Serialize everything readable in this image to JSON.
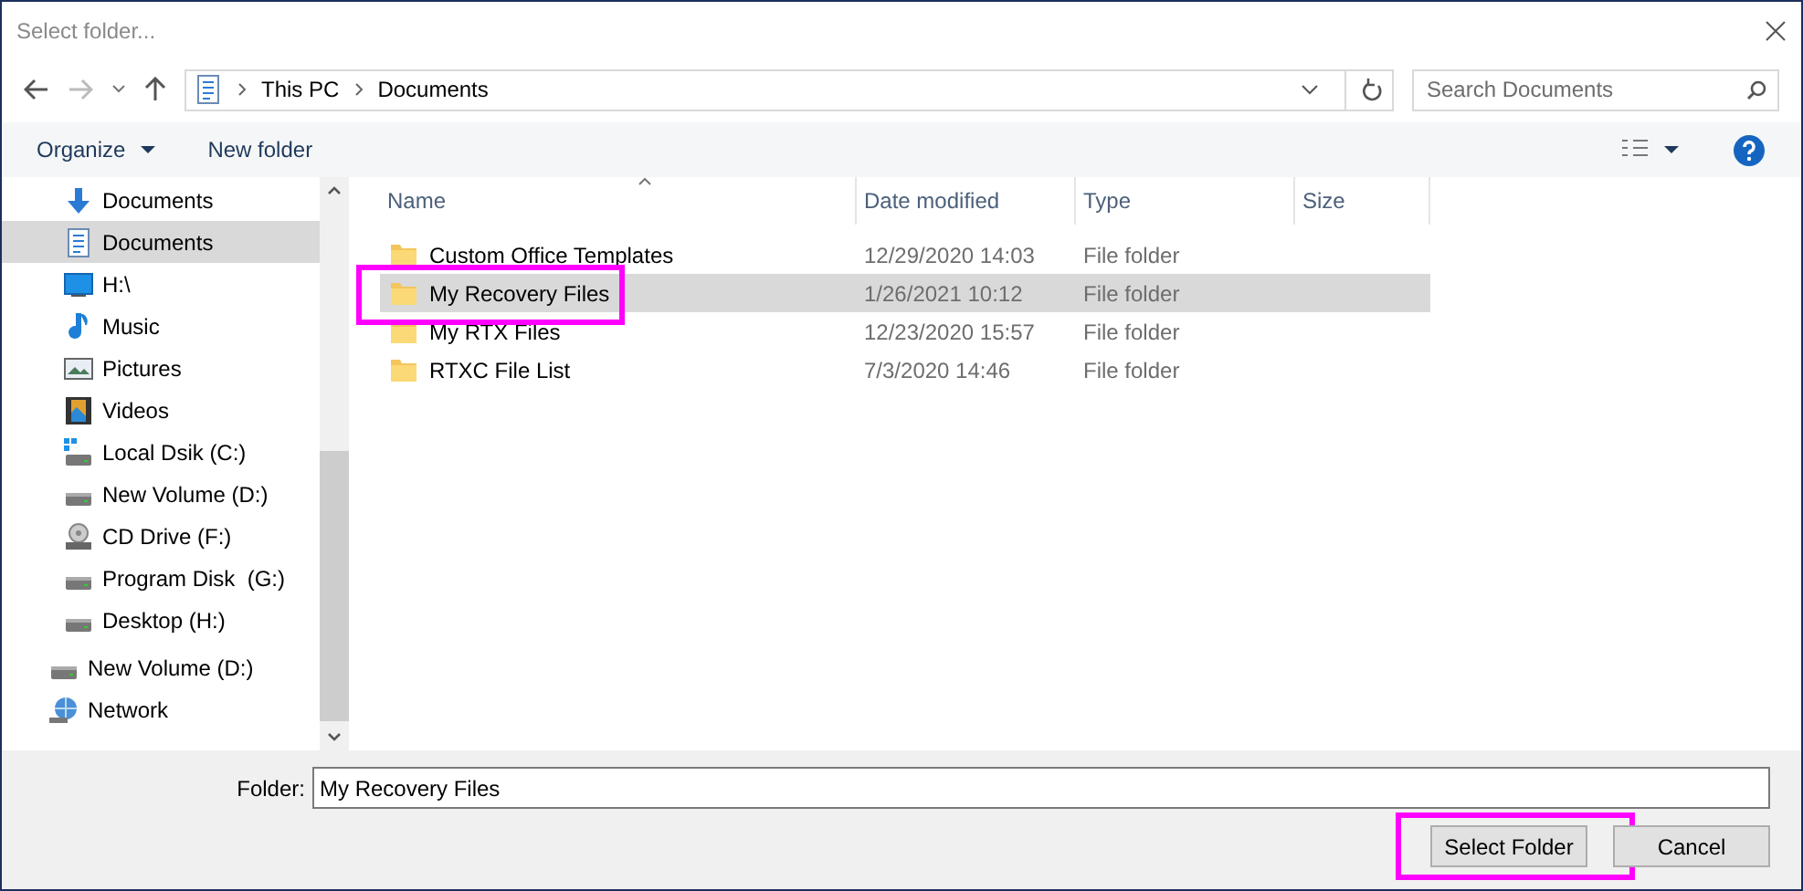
{
  "window": {
    "title": "Select folder..."
  },
  "address": {
    "path": [
      "This PC",
      "Documents"
    ]
  },
  "search": {
    "placeholder": "Search Documents"
  },
  "toolbar": {
    "organize": "Organize",
    "new_folder": "New folder"
  },
  "sidebar": {
    "items": [
      {
        "label": "Documents",
        "kind": "download",
        "selected": false
      },
      {
        "label": "Documents",
        "kind": "document",
        "selected": true
      },
      {
        "label": "H:\\",
        "kind": "monitor",
        "selected": false
      },
      {
        "label": "Music",
        "kind": "music",
        "selected": false
      },
      {
        "label": "Pictures",
        "kind": "picture",
        "selected": false
      },
      {
        "label": "Videos",
        "kind": "video",
        "selected": false
      },
      {
        "label": "Local Dsik (C:)",
        "kind": "system",
        "selected": false
      },
      {
        "label": "New Volume (D:)",
        "kind": "drive",
        "selected": false
      },
      {
        "label": "CD Drive (F:)",
        "kind": "cd",
        "selected": false
      },
      {
        "label": "Program Disk  (G:)",
        "kind": "drive",
        "selected": false
      },
      {
        "label": "Desktop (H:)",
        "kind": "drive",
        "selected": false
      }
    ],
    "top_level_items": [
      {
        "label": "New Volume (D:)",
        "kind": "drive",
        "selected": false
      },
      {
        "label": "Network",
        "kind": "network",
        "selected": false
      }
    ]
  },
  "table": {
    "columns": [
      "Name",
      "Date modified",
      "Type",
      "Size"
    ],
    "rows": [
      {
        "name": "Custom Office Templates",
        "date": "12/29/2020 14:03",
        "type": "File folder",
        "selected": false,
        "highlighted": false
      },
      {
        "name": "My Recovery Files",
        "date": "1/26/2021 10:12",
        "type": "File folder",
        "selected": true,
        "highlighted": true
      },
      {
        "name": "My RTX Files",
        "date": "12/23/2020 15:57",
        "type": "File folder",
        "selected": false,
        "highlighted": false
      },
      {
        "name": "RTXC File List",
        "date": "7/3/2020 14:46",
        "type": "File folder",
        "selected": false,
        "highlighted": false
      }
    ]
  },
  "folder_field": {
    "label": "Folder:",
    "value": "My Recovery Files"
  },
  "buttons": [
    {
      "label": "Select Folder",
      "highlighted": true
    },
    {
      "label": "Cancel",
      "highlighted": false
    }
  ]
}
